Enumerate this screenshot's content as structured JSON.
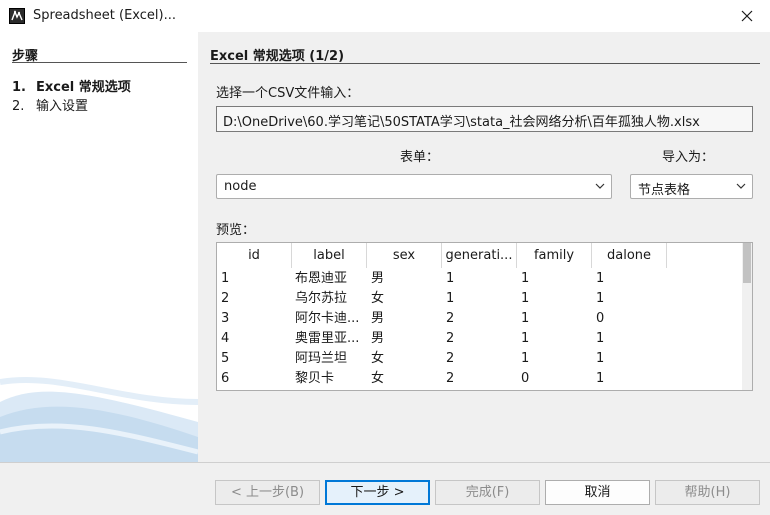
{
  "window": {
    "title": "Spreadsheet (Excel)..."
  },
  "steps": {
    "header": "步骤",
    "items": [
      {
        "num": "1.",
        "label": "Excel 常规选项"
      },
      {
        "num": "2.",
        "label": "输入设置"
      }
    ]
  },
  "main": {
    "title": "Excel 常规选项 (1/2)",
    "csv_label": "选择一个CSV文件输入：",
    "file_path": "D:\\OneDrive\\60.学习笔记\\50STATA学习\\stata_社会网络分析\\百年孤独人物.xlsx",
    "sheet_label": "表单：",
    "import_as_label": "导入为：",
    "sheet_value": "node",
    "import_as_value": "节点表格",
    "preview_label": "预览："
  },
  "preview": {
    "columns": [
      "id",
      "label",
      "sex",
      "generati...",
      "family",
      "dalone"
    ],
    "rows": [
      [
        "1",
        "布恩迪亚",
        "男",
        "1",
        "1",
        "1"
      ],
      [
        "2",
        "乌尔苏拉",
        "女",
        "1",
        "1",
        "1"
      ],
      [
        "3",
        "阿尔卡迪...",
        "男",
        "2",
        "1",
        "0"
      ],
      [
        "4",
        "奥雷里亚...",
        "男",
        "2",
        "1",
        "1"
      ],
      [
        "5",
        "阿玛兰坦",
        "女",
        "2",
        "1",
        "1"
      ],
      [
        "6",
        "黎贝卡",
        "女",
        "2",
        "0",
        "1"
      ]
    ]
  },
  "buttons": {
    "back": "< 上一步(B)",
    "next": "下一步 >",
    "finish": "完成(F)",
    "cancel": "取消",
    "help": "帮助(H)"
  },
  "icons": {
    "app": "app-logo-icon",
    "close": "close-icon",
    "dropdown": "chevron-down-icon"
  },
  "colors": {
    "accent": "#0078d7"
  }
}
